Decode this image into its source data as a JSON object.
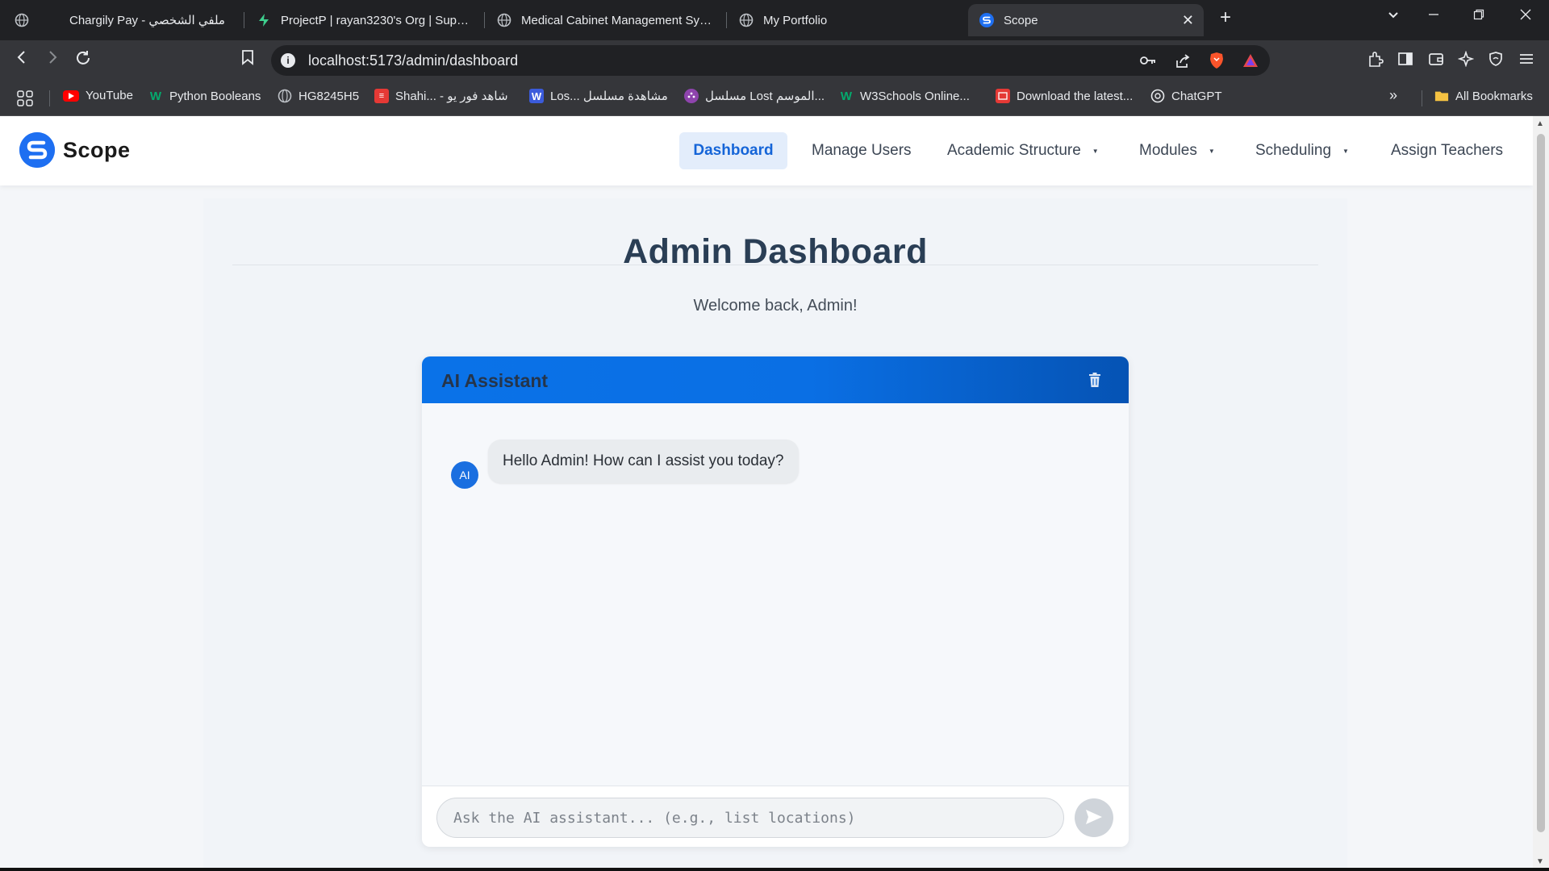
{
  "browser": {
    "tabs": [
      {
        "label": "Chargily Pay - ملفي الشخصي"
      },
      {
        "label": "ProjectP | rayan3230's Org | Supabase"
      },
      {
        "label": "Medical Cabinet Management System"
      },
      {
        "label": "My Portfolio"
      },
      {
        "label": "Scope",
        "active": true
      }
    ],
    "url": "localhost:5173/admin/dashboard",
    "bookmarks": [
      {
        "label": "YouTube"
      },
      {
        "label": "Python Booleans"
      },
      {
        "label": "HG8245H5"
      },
      {
        "label": "Shahi... - شاهد فور يو"
      },
      {
        "label": "Los... مشاهدة مسلسل"
      },
      {
        "label": "مسلسل Lost الموسم..."
      },
      {
        "label": "W3Schools Online..."
      },
      {
        "label": "Download the latest..."
      },
      {
        "label": "ChatGPT"
      }
    ],
    "all_bookmarks": "All Bookmarks"
  },
  "navbar": {
    "brand": "Scope",
    "items": [
      {
        "label": "Dashboard",
        "active": true
      },
      {
        "label": "Manage Users"
      },
      {
        "label": "Academic Structure",
        "dropdown": true
      },
      {
        "label": "Modules",
        "dropdown": true
      },
      {
        "label": "Scheduling",
        "dropdown": true
      },
      {
        "label": "Assign Teachers"
      }
    ]
  },
  "main": {
    "title": "Admin Dashboard",
    "welcome": "Welcome back, Admin!"
  },
  "chat": {
    "title": "AI Assistant",
    "messages": [
      {
        "sender": "AI",
        "text": "Hello Admin! How can I assist you today?"
      }
    ],
    "input_placeholder": "Ask the AI assistant... (e.g., list locations)",
    "input_value": ""
  },
  "colors": {
    "accent": "#0a72e8",
    "nav_active_bg": "#e3edfb",
    "title": "#2a3e55"
  }
}
